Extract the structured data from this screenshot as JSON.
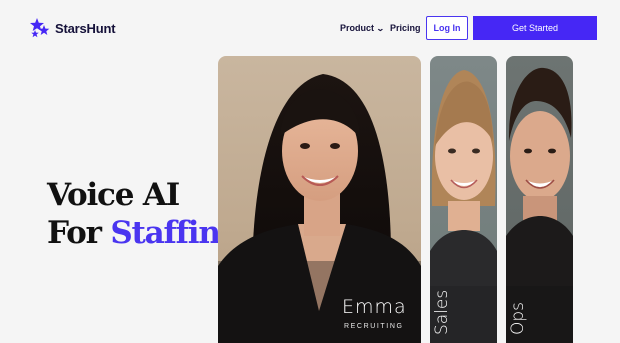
{
  "brand": {
    "name": "StarsHunt",
    "accent": "#4627f5"
  },
  "nav": {
    "product": "Product",
    "pricing": "Pricing",
    "login": "Log In",
    "get_started": "Get Started"
  },
  "hero": {
    "line1": "Voice AI",
    "line2_prefix": "For ",
    "line2_accent": "Staffing",
    "line2_suffix": "."
  },
  "cards": {
    "emma": {
      "name": "Emma",
      "role": "RECRUITING"
    },
    "sales": {
      "label": "Sales"
    },
    "ops": {
      "label": "Ops"
    }
  },
  "icons": {
    "logo": "stars-icon",
    "product_chevron": "chevron-down-icon"
  }
}
